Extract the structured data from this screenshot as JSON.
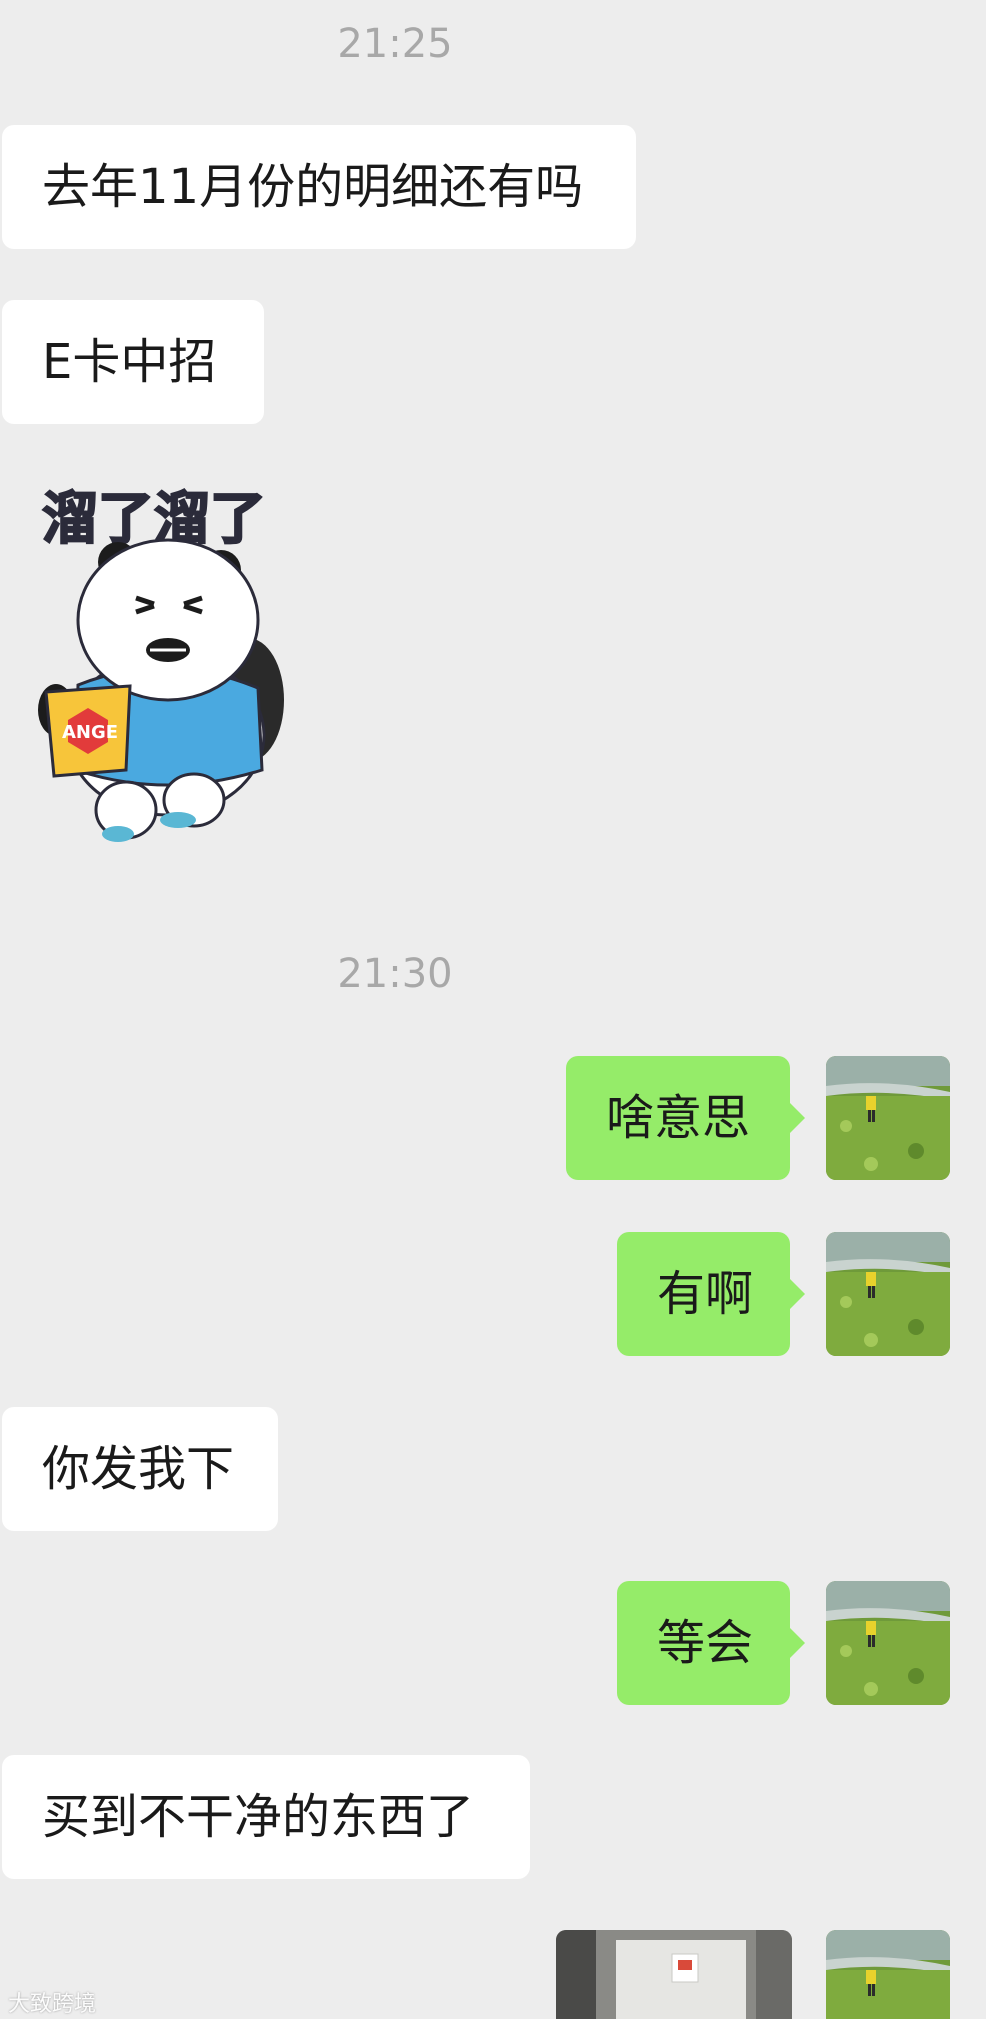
{
  "colors": {
    "background": "#ededed",
    "incoming_bubble": "#ffffff",
    "outgoing_bubble": "#95ec69",
    "timestamp_text": "#a8a8a8"
  },
  "timestamps": [
    "21:25",
    "21:30"
  ],
  "messages": {
    "m1": "去年11月份的明细还有吗",
    "m2": "E卡中招",
    "m3": "啥意思",
    "m4": "有啊",
    "m5": "你发我下",
    "m6": "等会",
    "m7": "买到不干净的东西了"
  },
  "sticker": {
    "caption": "溜了溜了",
    "bag_text": "ANGE"
  },
  "watermark": "大致跨境"
}
